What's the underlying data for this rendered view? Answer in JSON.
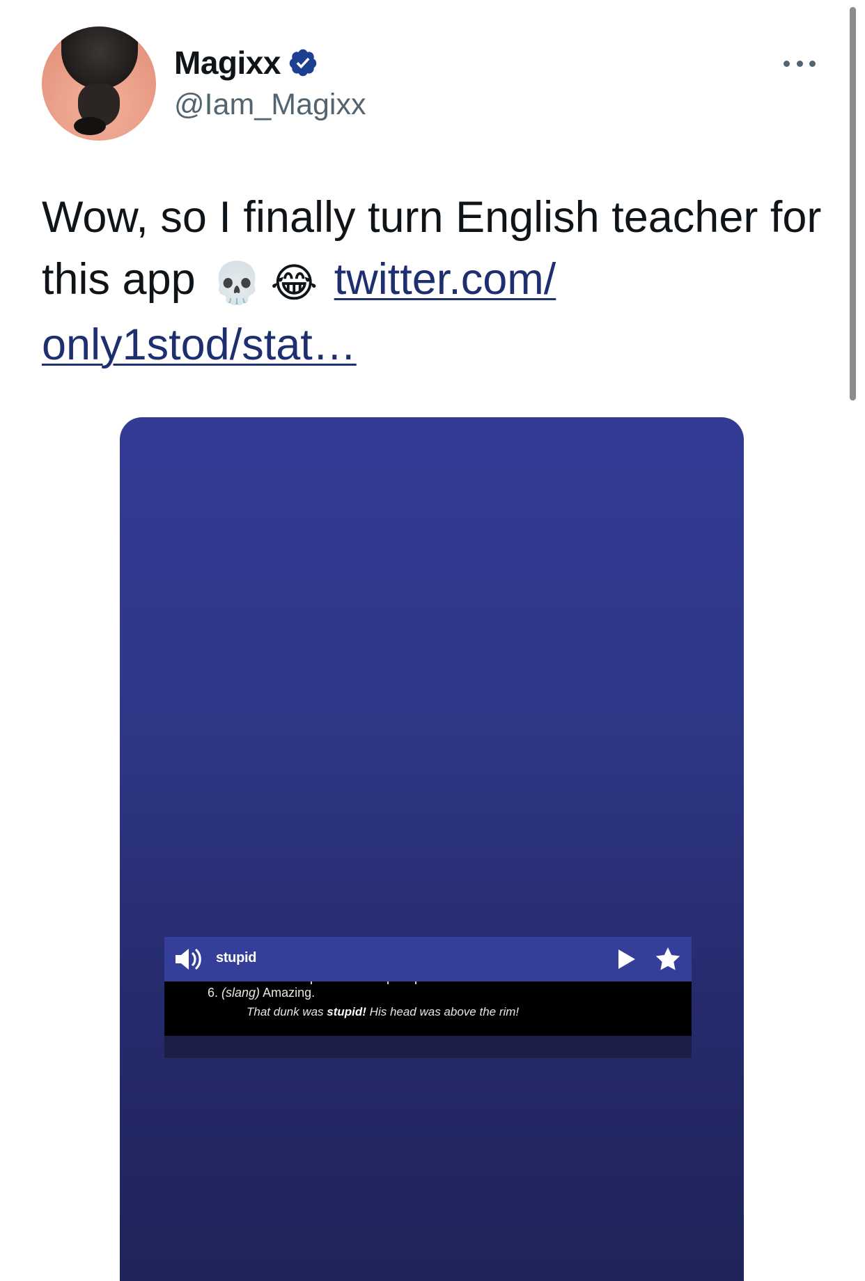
{
  "author": {
    "display_name": "Magixx",
    "handle": "@Iam_Magixx",
    "verified": true,
    "avatar_icon": "avatar-photo",
    "verified_icon": "verified-badge-icon",
    "more_icon": "more-options-icon"
  },
  "tweet": {
    "text": "Wow, so I finally turn English teacher for this app",
    "emoji_1": "💀",
    "emoji_2": "😂",
    "link_line_1": "twitter.com/",
    "link_line_2": "only1stod/stat…"
  },
  "media": {
    "word": "stupid",
    "definition_number": "6.",
    "definition_tag": "(slang)",
    "definition_text": "Amazing.",
    "example_pre": "That dunk was ",
    "example_bold": "stupid!",
    "example_post": " His head was above the rim!",
    "speaker_icon": "speaker-icon",
    "play_icon": "play-icon",
    "star_icon": "star-icon"
  },
  "colors": {
    "verified_blue": "#1d9bf0",
    "link": "#1d2f6f",
    "media_top": "#343b95",
    "media_bottom": "#1f2459",
    "card_header": "#353e99"
  }
}
